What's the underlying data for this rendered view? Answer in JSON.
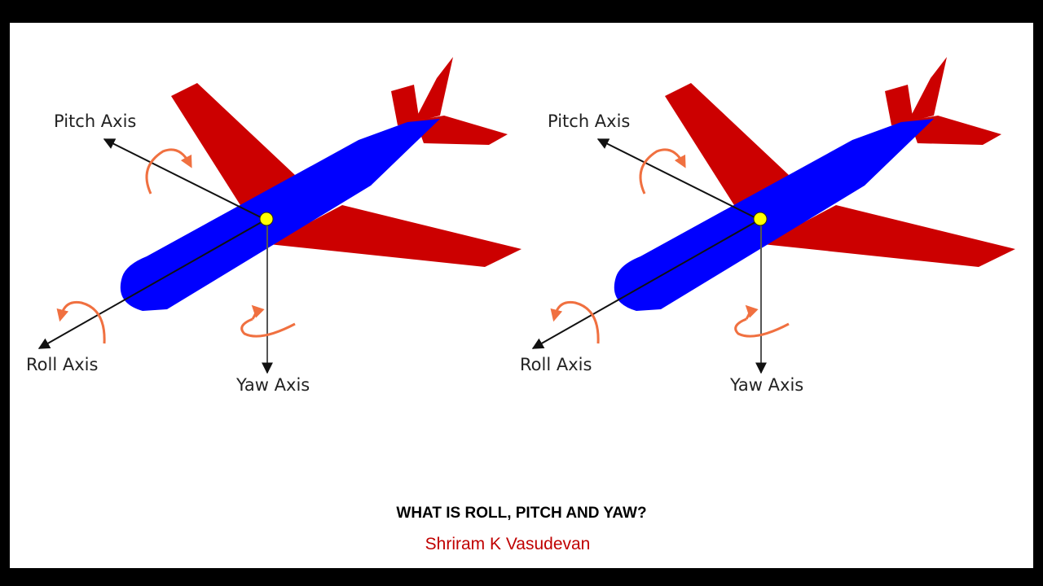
{
  "slide": {
    "title": "WHAT IS ROLL, PITCH AND YAW?",
    "author": "Shriram K Vasudevan"
  },
  "colors": {
    "fuselage": "#0000ff",
    "wings": "#cc0000",
    "rotation_arrow": "#f07040",
    "center_of_gravity": "#ffff00",
    "author_text": "#c00000"
  },
  "diagrams": [
    {
      "labels": {
        "pitch": "Pitch Axis",
        "roll": "Roll Axis",
        "yaw": "Yaw Axis"
      }
    },
    {
      "labels": {
        "pitch": "Pitch Axis",
        "roll": "Roll Axis",
        "yaw": "Yaw Axis"
      }
    }
  ]
}
